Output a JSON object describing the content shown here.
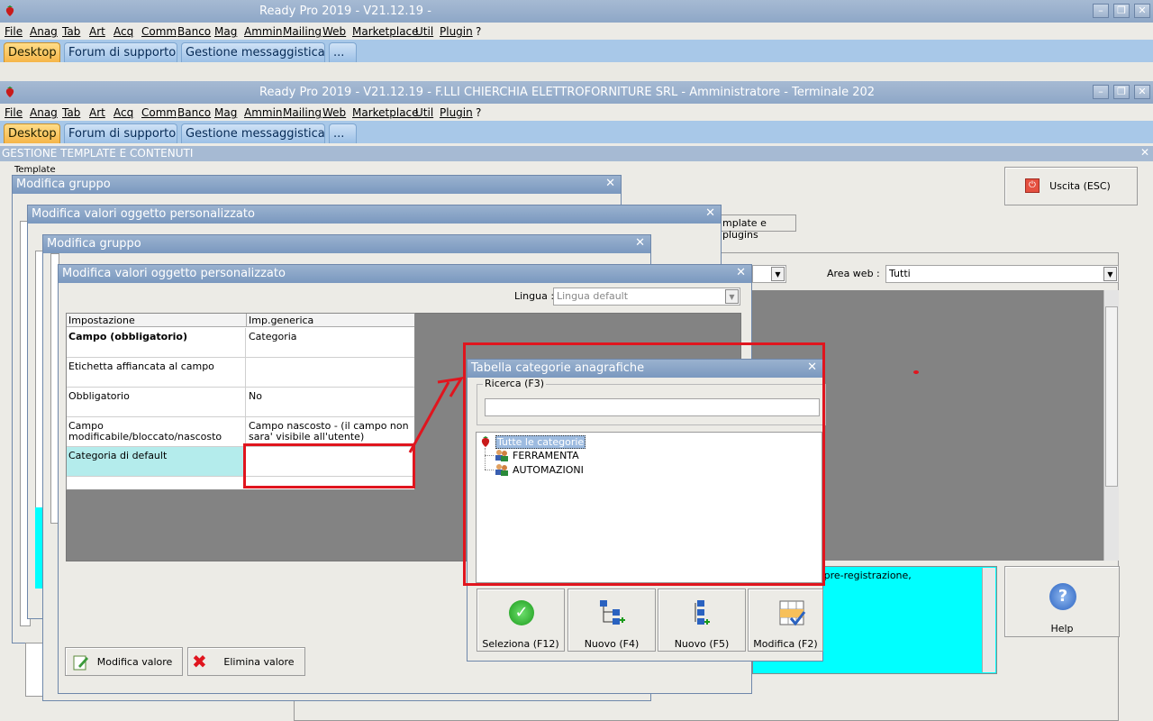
{
  "app": {
    "title_back": "Ready Pro 2019 - V21.12.19 -",
    "title_front": "Ready Pro 2019 - V21.12.19 - F.LLI CHIERCHIA ELETTROFORNITURE SRL - Amministratore - Terminale 202"
  },
  "menu": [
    "File",
    "Anag",
    "Tab",
    "Art",
    "Acq",
    "Comm",
    "Banco",
    "Mag",
    "Ammin",
    "Mailing",
    "Web",
    "Marketplace",
    "Util",
    "Plugin",
    "?"
  ],
  "tabs": [
    "Desktop",
    "Forum di supporto",
    "Gestione messaggistica",
    "..."
  ],
  "section": {
    "title": "GESTIONE TEMPLATE E CONTENUTI",
    "template_label": "Template",
    "uscita": "Uscita (ESC)",
    "tab_template_plugins": "mplate e plugins",
    "area_web_label": "Area web :",
    "area_web_value": "Tutti",
    "info_text": "ziale/finale di pre-registrazione,",
    "help": "Help"
  },
  "dialogs": {
    "modifica_gruppo": "Modifica gruppo",
    "modifica_valori": "Modifica valori oggetto personalizzato",
    "lingua_label": "Lingua :",
    "lingua_value": "Lingua default",
    "grid": {
      "col1": "Impostazione",
      "col2": "Imp.generica",
      "rows": [
        {
          "key": "Campo (obbligatorio)",
          "value": "Categoria"
        },
        {
          "key": "Etichetta affiancata al campo",
          "value": ""
        },
        {
          "key": "Obbligatorio",
          "value": "No"
        },
        {
          "key": "Campo modificabile/bloccato/nascosto",
          "value": "Campo nascosto - (il campo non sara' visibile all'utente)"
        },
        {
          "key": "Categoria di default",
          "value": ""
        }
      ]
    },
    "modifica_valore_btn": "Modifica valore",
    "elimina_valore_btn": "Elimina valore"
  },
  "categorie": {
    "title": "Tabella categorie anagrafiche",
    "ricerca_label": "Ricerca (F3)",
    "ricerca_value": "",
    "root": "Tutte le categorie",
    "items": [
      "FERRAMENTA",
      "AUTOMAZIONI"
    ],
    "buttons": [
      "Seleziona (F12)",
      "Nuovo (F4)",
      "Nuovo (F5)",
      "Modifica (F2)"
    ]
  },
  "colors": {
    "titlebar": "#8ea7c7",
    "highlight_row": "#b4ecec",
    "annotation_red": "#e0151e",
    "tab_active": "#f5b548"
  }
}
